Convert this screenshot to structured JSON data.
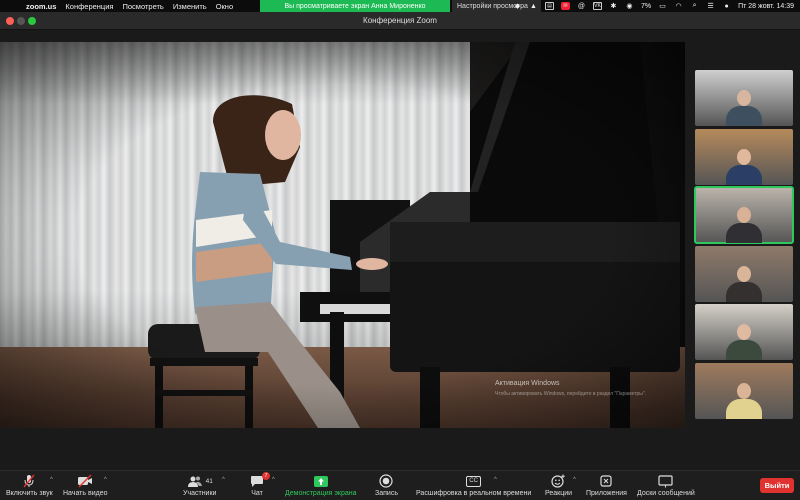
{
  "menubar": {
    "app_name": "zoom.us",
    "items": [
      "Конференция",
      "Посмотреть",
      "Изменить",
      "Окно"
    ],
    "share_banner": "Вы просматриваете экран Анна Мироненко",
    "view_options": "Настройки просмотра",
    "tray": {
      "vk": "VK",
      "battery": "7%",
      "datetime": "Пт 28 жовт.  14:39"
    }
  },
  "window": {
    "title": "Конференция Zoom"
  },
  "main_video": {
    "watermark_title": "Активация Windows",
    "watermark_sub": "Чтобы активировать Windows, перейдите в раздел \"Параметры\"."
  },
  "gallery": {
    "active_index": 2,
    "participants": [
      {
        "bg": "#cfcfcf",
        "skin": "#d8b59f",
        "shirt": "#3e5060"
      },
      {
        "bg": "#b68a5b",
        "skin": "#e0b89c",
        "shirt": "#2b3e66"
      },
      {
        "bg": "#bcb5ac",
        "skin": "#d8b196",
        "shirt": "#2f2f34"
      },
      {
        "bg": "#8f7a6a",
        "skin": "#d9b59a",
        "shirt": "#33302f"
      },
      {
        "bg": "#d5d1c9",
        "skin": "#dfb9a0",
        "shirt": "#3c4a3e"
      },
      {
        "bg": "#9f7b5e",
        "skin": "#dbb495",
        "shirt": "#e1d28f"
      }
    ]
  },
  "toolbar": {
    "mute": "Включить звук",
    "video": "Начать видео",
    "participants": "Участники",
    "participants_count": "41",
    "chat": "Чат",
    "chat_badge": "7",
    "share": "Демонстрация экрана",
    "record": "Запись",
    "transcript": "Расшифровка в реальном времени",
    "transcript_icon": "CC",
    "reactions": "Реакции",
    "apps": "Приложения",
    "whiteboard": "Доски сообщений",
    "leave": "Выйти"
  },
  "colors": {
    "share_green": "#2fc85d",
    "leave_red": "#e0332f"
  }
}
